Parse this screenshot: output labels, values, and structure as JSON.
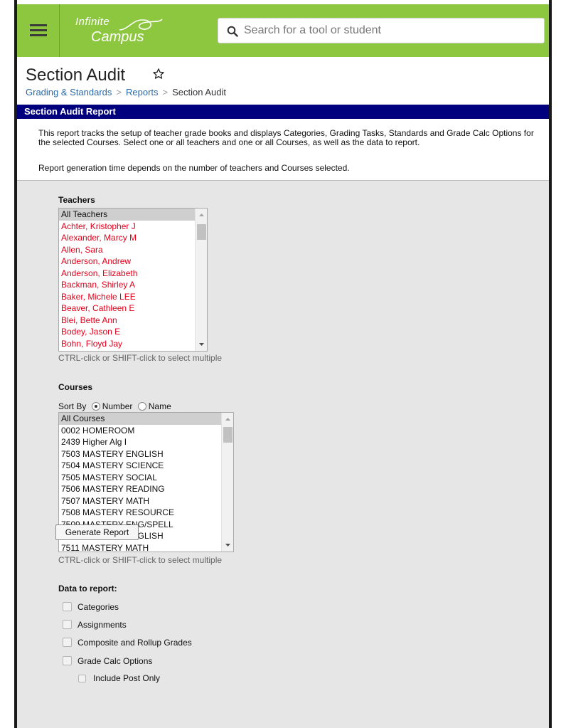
{
  "header": {
    "logo_line1": "Infinite",
    "logo_line2": "Campus",
    "search_placeholder": "Search for a tool or student"
  },
  "page": {
    "title": "Section Audit",
    "breadcrumb": [
      "Grading & Standards",
      "Reports",
      "Section Audit"
    ]
  },
  "report": {
    "header": "Section Audit Report",
    "description": "This report tracks the setup of teacher grade books and displays Categories, Grading Tasks, Standards and Grade Calc Options for the selected Courses. Select one or all teachers and one or all Courses, as well as the data to report.",
    "description2": "Report generation time depends on the number of teachers and Courses selected."
  },
  "teachers": {
    "label": "Teachers",
    "options": [
      "All Teachers",
      "Achter, Kristopher J",
      "Alexander, Marcy M",
      "Allen, Sara",
      "Anderson, Andrew",
      "Anderson, Elizabeth",
      "Backman, Shirley A",
      "Baker, Michele LEE",
      "Beaver, Cathleen E",
      "Blei, Bette Ann",
      "Bodey, Jason E",
      "Bohn, Floyd Jay"
    ],
    "hint": "CTRL-click or SHIFT-click to select multiple"
  },
  "courses": {
    "label": "Courses",
    "sort_by_label": "Sort By",
    "sort_number": "Number",
    "sort_name": "Name",
    "options": [
      "All Courses",
      "0002 HOMEROOM",
      "2439 Higher Alg I",
      "7503 MASTERY ENGLISH",
      "7504 MASTERY SCIENCE",
      "7505 MASTERY SOCIAL",
      "7506 MASTERY READING",
      "7507 MASTERY MATH",
      "7508 MASTERY RESOURCE",
      "7509 MASTERY ENG/SPELL",
      "7510 MASTERY ENGLISH",
      "7511 MASTERY MATH"
    ],
    "hint": "CTRL-click or SHIFT-click to select multiple"
  },
  "data_to_report": {
    "label": "Data to report:",
    "categories": "Categories",
    "assignments": "Assignments",
    "composite": "Composite and Rollup Grades",
    "grade_calc": "Grade Calc Options",
    "include_post": "Include Post Only"
  },
  "generate_button": "Generate Report",
  "colors": {
    "topbar": "#8dc63f",
    "report_header": "#00007f",
    "teacher_text": "#e3001b",
    "link": "#2b6aa8"
  }
}
